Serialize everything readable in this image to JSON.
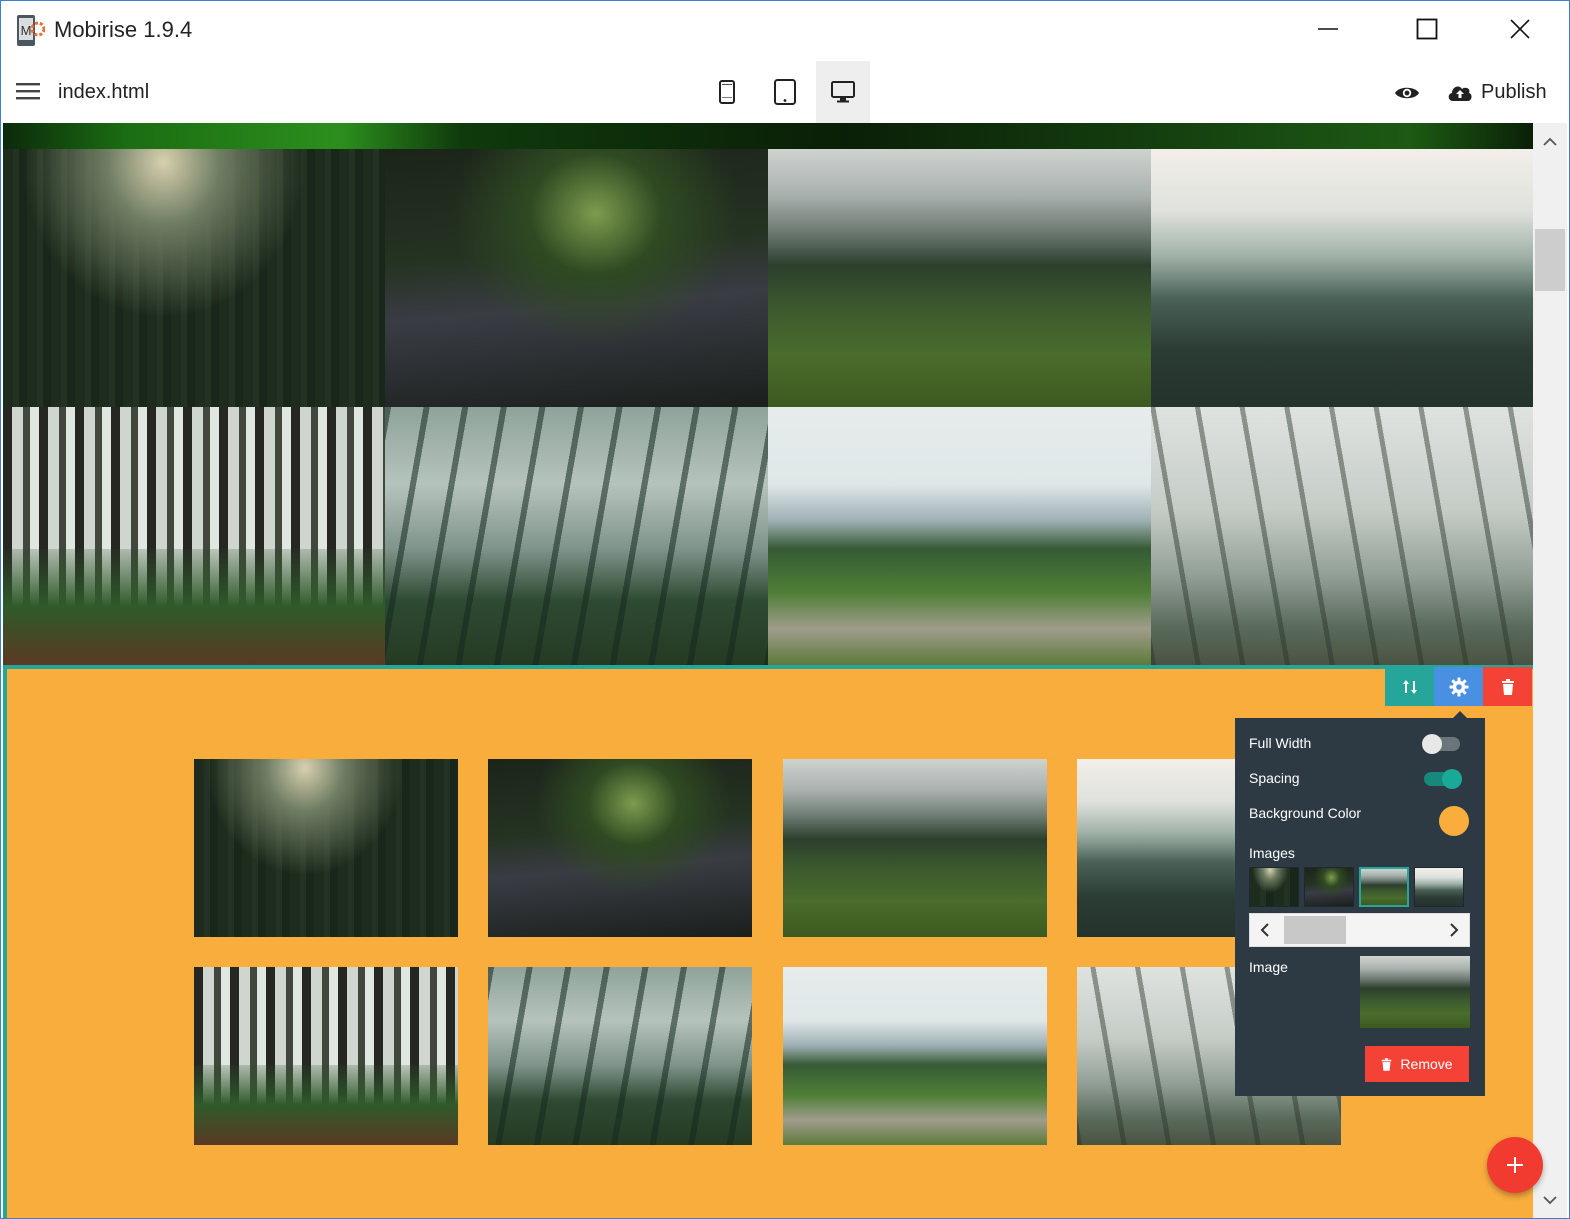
{
  "window": {
    "title": "Mobirise 1.9.4",
    "controls": {
      "minimize": "minimize-icon",
      "maximize": "maximize-icon",
      "close": "close-icon"
    }
  },
  "toolbar": {
    "page_name": "index.html",
    "devices": [
      "mobile",
      "tablet",
      "desktop"
    ],
    "active_device": "desktop",
    "publish_label": "Publish"
  },
  "full_gallery": {
    "images": [
      "forest-sunbeam",
      "forest-bridge",
      "misty-hills",
      "foggy-pines",
      "forest-trail",
      "leaning-trees",
      "mountain-road",
      "misty-birches"
    ]
  },
  "section": {
    "background_color": "#f9ad3d",
    "actions": {
      "move": "move-icon",
      "settings": "gear-icon",
      "delete": "trash-icon"
    }
  },
  "settings_panel": {
    "full_width_label": "Full Width",
    "full_width": false,
    "spacing_label": "Spacing",
    "spacing": true,
    "background_color_label": "Background Color",
    "background_color": "#f9ad3d",
    "images_label": "Images",
    "thumbnails": [
      "forest-sunbeam",
      "forest-bridge",
      "misty-hills",
      "foggy-pines"
    ],
    "selected_thumbnail": 2,
    "image_label": "Image",
    "remove_label": "Remove"
  },
  "colors": {
    "accent": "#26a69a",
    "gear": "#4a90e2",
    "danger": "#f44336",
    "panel": "#2d3a44",
    "orange": "#f9ad3d"
  }
}
